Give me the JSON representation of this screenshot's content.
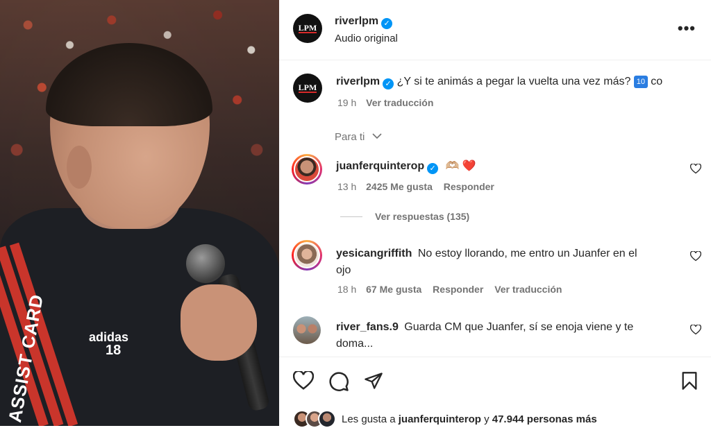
{
  "post": {
    "author": "riverlpm",
    "audio": "Audio original",
    "logo_text": "LPM"
  },
  "caption": {
    "author": "riverlpm",
    "text": "¿Y si te animás a pegar la vuelta una vez más?",
    "badge": "10",
    "trailing": "co",
    "time": "19 h",
    "translate": "Ver traducción"
  },
  "filter": {
    "label": "Para ti"
  },
  "comments": [
    {
      "user": "juanferquinterop",
      "text": "🫶🏼 ❤️",
      "time": "13 h",
      "likes": "2425 Me gusta",
      "reply": "Responder",
      "view_replies": "Ver respuestas (135)"
    },
    {
      "user": "yesicangriffith",
      "text": "No estoy llorando, me entro un Juanfer en el",
      "text2": "ojo",
      "time": "18 h",
      "likes": "67 Me gusta",
      "reply": "Responder",
      "translate": "Ver traducción"
    },
    {
      "user": "river_fans.9",
      "text": "Guarda CM que Juanfer, sí se enoja viene y te",
      "text2": "doma..."
    }
  ],
  "likes_line": {
    "prefix": "Les gusta a",
    "user": "juanferquinterop",
    "joiner": "y",
    "count": "47.944 personas más"
  },
  "media": {
    "jersey_brand": "adidas",
    "jersey_number": "18",
    "sleeve_text": "ASSIST CARD"
  },
  "icons": [
    "verified-icon",
    "more-icon",
    "heart-icon",
    "comment-icon",
    "share-icon",
    "bookmark-icon",
    "chevron-down-icon"
  ]
}
